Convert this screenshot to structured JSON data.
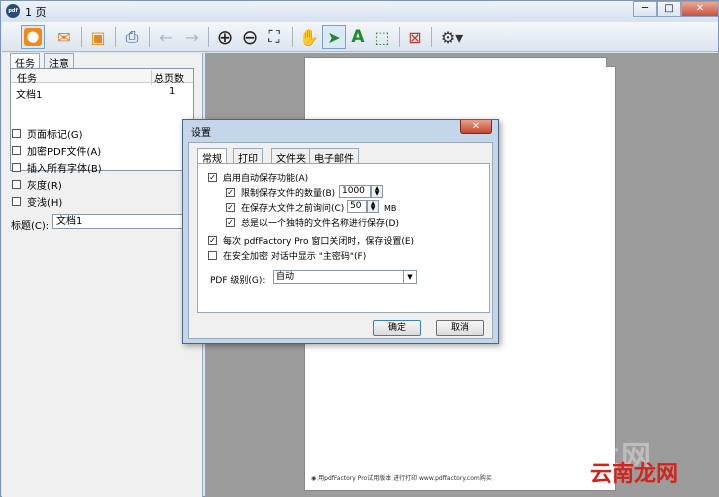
{
  "window": {
    "title": "1 页",
    "logo": "pdf",
    "minimize": "─",
    "maximize": "□",
    "close": "✕"
  },
  "toolbar": {
    "icons": [
      "pdf-icon",
      "email-icon",
      "save-icon",
      "print-icon",
      "back-arrow-icon",
      "forward-arrow-icon",
      "zoom-in-icon",
      "zoom-out-icon",
      "fit-page-icon",
      "hand-icon",
      "select-arrow-icon",
      "text-tool-icon",
      "crop-tool-icon",
      "delete-page-icon",
      "settings-gear-icon"
    ],
    "pdf_glyph": "⬤",
    "email_glyph": "✉",
    "save_glyph": "▣",
    "print_glyph": "⎙",
    "back_glyph": "←",
    "forward_glyph": "→",
    "zoom_in_glyph": "⊕",
    "zoom_out_glyph": "⊖",
    "fit_glyph": "⛶",
    "hand_glyph": "✋",
    "select_glyph": "➤",
    "text_glyph": "A",
    "crop_glyph": "⬚",
    "delete_glyph": "⊠",
    "settings_glyph": "⚙▾"
  },
  "left_panel": {
    "tabs": [
      "任务",
      "注意"
    ],
    "task_columns": [
      "任务",
      "总页数"
    ],
    "tasks": [
      {
        "name": "文档1",
        "pages": "1"
      }
    ],
    "options": [
      "页面标记(G)",
      "加密PDF文件(A)",
      "插入所有字体(B)",
      "灰度(R)",
      "变浅(H)"
    ],
    "title_label": "标题(C):",
    "title_value": "文档1"
  },
  "preview": {
    "footer": "◉ 用pdfFactory Pro试用版本 进行打印 www.pdffactory.com购买"
  },
  "watermark": {
    "faint": "云南龙网",
    "brand": "云南龙网"
  },
  "dialog": {
    "title": "设置",
    "close": "✕",
    "tabs": [
      "常规",
      "打印",
      "文件夹",
      "电子邮件"
    ],
    "options": {
      "autosave": "启用自动保存功能(A)",
      "limit_count": "限制保存文件的数量(B)",
      "limit_count_value": "1000",
      "ask_before": "在保存大文件之前询问(C)",
      "ask_before_value": "50",
      "ask_unit": "MB",
      "unique_name": "总是以一个独特的文件名称进行保存(D)",
      "save_on_close": "每次 pdfFactory Pro 窗口关闭时，保存设置(E)",
      "show_master_pwd": "在安全加密 对话中显示 \"主密码\"(F)"
    },
    "pdf_level_label": "PDF 级别(G):",
    "pdf_level_value": "自动",
    "checked_mark": "✓",
    "ok": "确定",
    "cancel": "取消"
  }
}
